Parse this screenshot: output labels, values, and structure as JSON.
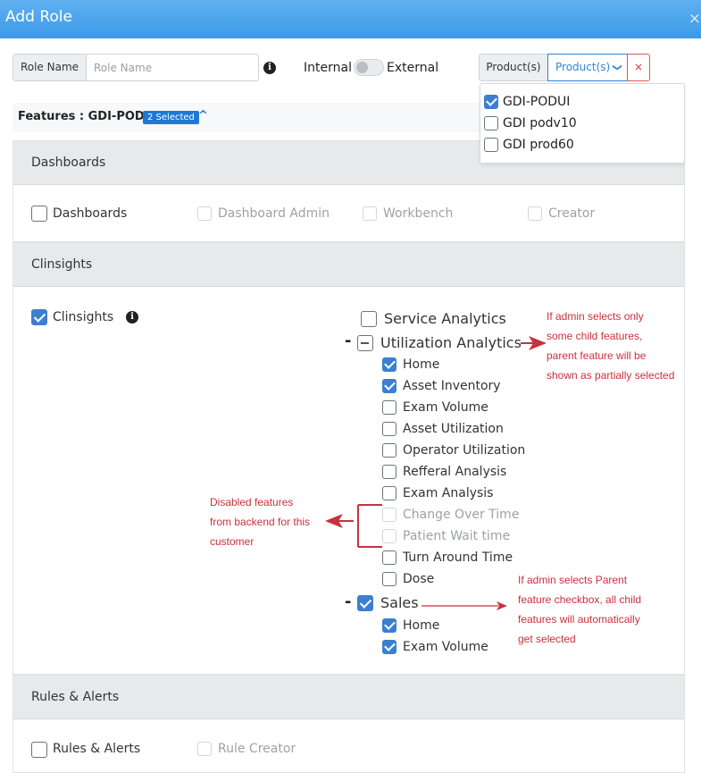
{
  "header": {
    "title": "Add Role",
    "close": "×"
  },
  "form": {
    "role_name_label": "Role Name",
    "role_name_placeholder": "Role Name",
    "info": "i",
    "internal_label": "Internal",
    "external_label": "External",
    "products_label": "Product(s)",
    "products_select": "Product(s)",
    "products_chevron": "❯",
    "clear": "×",
    "product_options": [
      {
        "label": "GDI-PODUI",
        "checked": true
      },
      {
        "label": "GDI podv10",
        "checked": false
      },
      {
        "label": "GDI prod60",
        "checked": false
      }
    ]
  },
  "features": {
    "title": "Features : GDI-PODUI",
    "badge": "2 Selected",
    "caret": "^"
  },
  "sections": {
    "dashboards": {
      "title": "Dashboards",
      "items": [
        {
          "label": "Dashboards",
          "state": "unchecked"
        },
        {
          "label": "Dashboard Admin",
          "state": "disabled"
        },
        {
          "label": "Workbench",
          "state": "disabled"
        },
        {
          "label": "Creator",
          "state": "disabled"
        }
      ]
    },
    "clinsights": {
      "title": "Clinsights",
      "main_label": "Clinsights",
      "service_analytics": "Service Analytics",
      "utilization_analytics": "Utilization Analytics",
      "utilization_children": [
        {
          "label": "Home",
          "state": "checked"
        },
        {
          "label": "Asset Inventory",
          "state": "checked"
        },
        {
          "label": "Exam Volume",
          "state": "unchecked"
        },
        {
          "label": "Asset Utilization",
          "state": "unchecked"
        },
        {
          "label": "Operator Utilization",
          "state": "unchecked"
        },
        {
          "label": "Refferal Analysis",
          "state": "unchecked"
        },
        {
          "label": "Exam Analysis",
          "state": "unchecked"
        },
        {
          "label": "Change Over Time",
          "state": "disabled"
        },
        {
          "label": "Patient Wait time",
          "state": "disabled"
        },
        {
          "label": "Turn Around Time",
          "state": "unchecked"
        },
        {
          "label": "Dose",
          "state": "unchecked"
        }
      ],
      "sales": "Sales",
      "sales_children": [
        {
          "label": "Home",
          "state": "checked"
        },
        {
          "label": "Exam Volume",
          "state": "checked"
        }
      ],
      "dash": "-"
    },
    "rules": {
      "title": "Rules & Alerts",
      "items": [
        {
          "label": "Rules & Alerts",
          "state": "unchecked"
        },
        {
          "label": "Rule Creator",
          "state": "disabled"
        }
      ]
    }
  },
  "annotations": {
    "partial": [
      "If admin selects only",
      "some child features,",
      "parent feature will be",
      "shown as partially selected"
    ],
    "disabled": [
      "Disabled features",
      "from backend for this",
      "customer"
    ],
    "parent": [
      "If admin selects Parent",
      "feature checkbox, all child",
      "features will automatically",
      "get selected"
    ],
    "color": "#c8323c"
  }
}
